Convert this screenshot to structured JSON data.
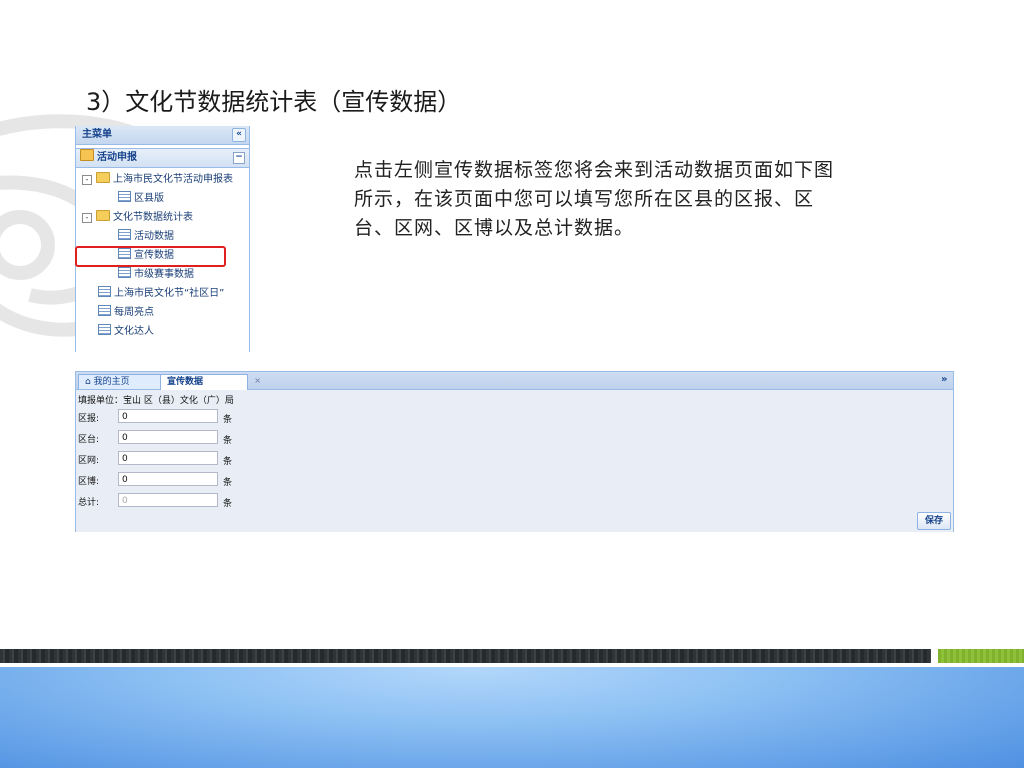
{
  "slide": {
    "title": "3）文化节数据统计表（宣传数据）",
    "description": "点击左侧宣传数据标签您将会来到活动数据页面如下图所示，在该页面中您可以填写您所在区县的区报、区台、区网、区博以及总计数据。"
  },
  "menu": {
    "header": "主菜单",
    "collapse_glyph": "«",
    "group": "活动申报",
    "tree": [
      {
        "label": "上海市民文化节活动申报表",
        "type": "folder",
        "expander": "-"
      },
      {
        "label": "区县版",
        "type": "doc"
      },
      {
        "label": "文化节数据统计表",
        "type": "folder",
        "expander": "-"
      },
      {
        "label": "活动数据",
        "type": "doc"
      },
      {
        "label": "宣传数据",
        "type": "doc",
        "selected": true
      },
      {
        "label": "市级赛事数据",
        "type": "doc"
      },
      {
        "label": "上海市民文化节“社区日”",
        "type": "doc"
      },
      {
        "label": "每周亮点",
        "type": "doc"
      },
      {
        "label": "文化达人",
        "type": "doc"
      }
    ]
  },
  "form": {
    "tabs": [
      {
        "label": "我的主页",
        "icon": "home-icon"
      },
      {
        "label": "宣传数据",
        "active": true
      }
    ],
    "tab_close_glyph": "×",
    "tab_scroll_glyph": "»",
    "unit_line": "填报单位：宝山 区（县）文化（广）局",
    "fields": [
      {
        "label": "区报:",
        "value": "0",
        "unit": "条"
      },
      {
        "label": "区台:",
        "value": "0",
        "unit": "条"
      },
      {
        "label": "区网:",
        "value": "0",
        "unit": "条"
      },
      {
        "label": "区博:",
        "value": "0",
        "unit": "条"
      },
      {
        "label": "总计:",
        "value": "0",
        "unit": "条",
        "disabled": true
      }
    ],
    "save_label": "保存"
  },
  "colors": {
    "accent_blue": "#99bbe8",
    "highlight_red": "#e0201f",
    "footer_green": "#8fc23a",
    "footer_blue": "#4f90e2"
  }
}
